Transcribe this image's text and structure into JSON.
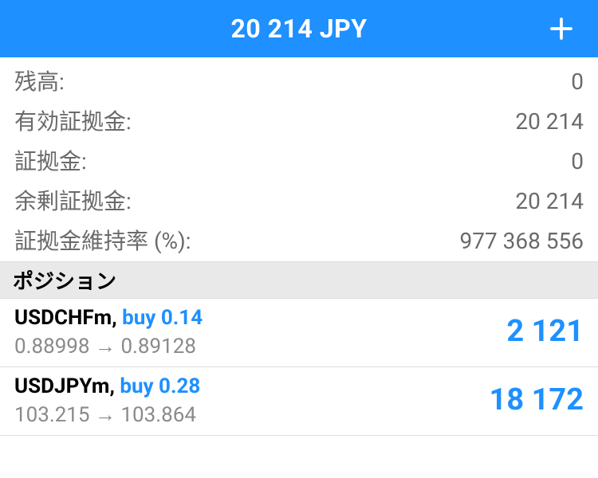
{
  "header": {
    "title": "20 214 JPY"
  },
  "account": {
    "balance_label": "残高:",
    "balance_value": "0",
    "equity_label": "有効証拠金:",
    "equity_value": "20 214",
    "margin_label": "証拠金:",
    "margin_value": "0",
    "free_margin_label": "余剰証拠金:",
    "free_margin_value": "20 214",
    "margin_level_label": "証拠金維持率 (%):",
    "margin_level_value": "977 368 556"
  },
  "sections": {
    "positions": "ポジション"
  },
  "positions": [
    {
      "symbol": "USDCHFm",
      "action": "buy 0.14",
      "price_from": "0.88998",
      "price_to": "0.89128",
      "pl": "2 121"
    },
    {
      "symbol": "USDJPYm",
      "action": "buy 0.28",
      "price_from": "103.215",
      "price_to": "103.864",
      "pl": "18 172"
    }
  ]
}
